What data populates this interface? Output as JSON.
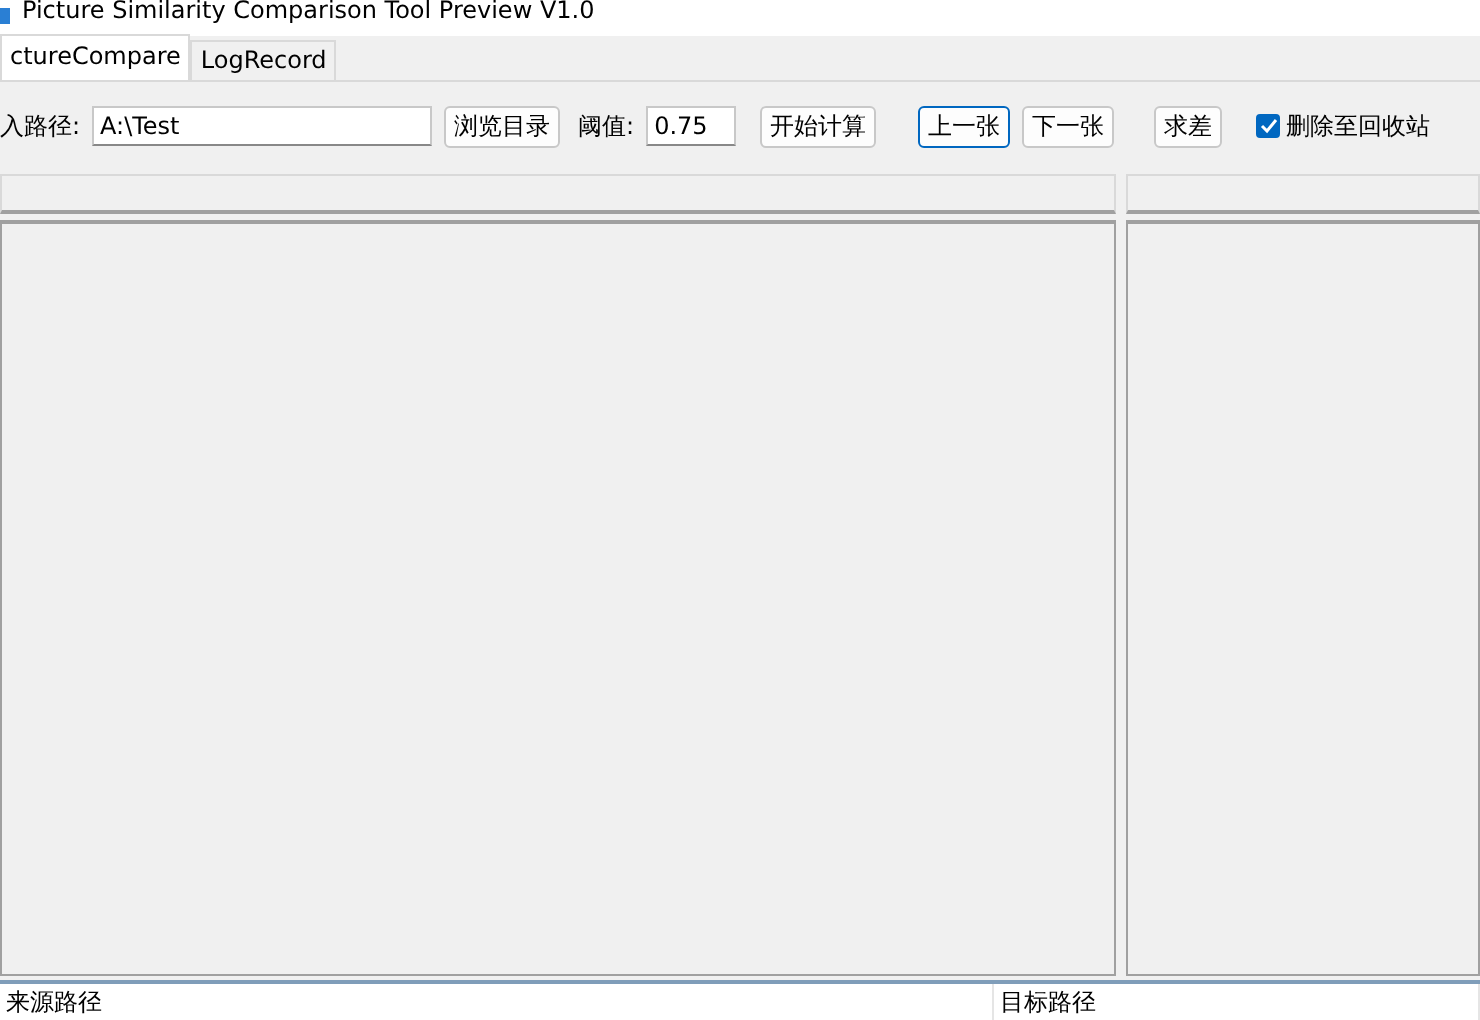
{
  "window": {
    "title": "Picture Similarity Comparison Tool Preview V1.0"
  },
  "tabs": [
    {
      "label": "ctureCompare",
      "selected": true
    },
    {
      "label": "LogRecord",
      "selected": false
    }
  ],
  "toolbar": {
    "path_label": "入路径:",
    "path_value": "A:\\Test",
    "browse_button": "浏览目录",
    "threshold_label": "阈值:",
    "threshold_value": "0.75",
    "start_button": "开始计算",
    "prev_button": "上一张",
    "next_button": "下一张",
    "diff_button": "求差",
    "recycle": {
      "label": "删除至回收站",
      "checked": true
    }
  },
  "result_list": {
    "columns": [
      "来源路径",
      "目标路径"
    ]
  }
}
